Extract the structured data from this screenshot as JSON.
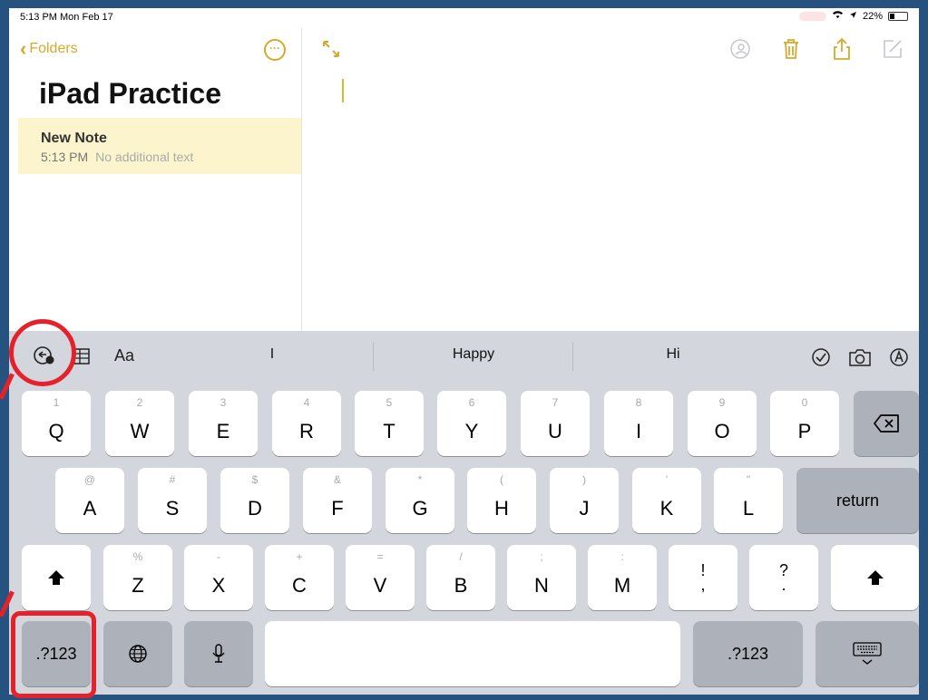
{
  "status": {
    "time": "5:13 PM  Mon Feb 17",
    "battery": "22%"
  },
  "sidebar": {
    "back_label": "Folders",
    "more_icon": "ellipsis-circle-icon",
    "folder_title": "iPad Practice",
    "note": {
      "title": "New Note",
      "time": "5:13 PM",
      "preview": "No additional text"
    }
  },
  "editor": {
    "icons": [
      "expand-icon",
      "collaborate-icon",
      "trash-icon",
      "share-icon",
      "compose-icon"
    ],
    "accent": "#e2b52c"
  },
  "keyboard": {
    "tools": {
      "format_label": "Aa"
    },
    "suggestions": [
      "I",
      "Happy",
      "Hi"
    ],
    "row1": [
      {
        "k": "Q",
        "h": "1"
      },
      {
        "k": "W",
        "h": "2"
      },
      {
        "k": "E",
        "h": "3"
      },
      {
        "k": "R",
        "h": "4"
      },
      {
        "k": "T",
        "h": "5"
      },
      {
        "k": "Y",
        "h": "6"
      },
      {
        "k": "U",
        "h": "7"
      },
      {
        "k": "I",
        "h": "8"
      },
      {
        "k": "O",
        "h": "9"
      },
      {
        "k": "P",
        "h": "0"
      }
    ],
    "row2": [
      {
        "k": "A",
        "h": "@"
      },
      {
        "k": "S",
        "h": "#"
      },
      {
        "k": "D",
        "h": "$"
      },
      {
        "k": "F",
        "h": "&"
      },
      {
        "k": "G",
        "h": "*"
      },
      {
        "k": "H",
        "h": "("
      },
      {
        "k": "J",
        "h": ")"
      },
      {
        "k": "K",
        "h": "'"
      },
      {
        "k": "L",
        "h": "\""
      }
    ],
    "row3": [
      {
        "k": "Z",
        "h": "%"
      },
      {
        "k": "X",
        "h": "-"
      },
      {
        "k": "C",
        "h": "+"
      },
      {
        "k": "V",
        "h": "="
      },
      {
        "k": "B",
        "h": "/"
      },
      {
        "k": "N",
        "h": ";"
      },
      {
        "k": "M",
        "h": ":"
      }
    ],
    "punct1": {
      "top": "!",
      "bottom": ","
    },
    "punct2": {
      "top": "?",
      "bottom": "."
    },
    "return_label": "return",
    "numbers_label": ".?123",
    "annotation_color": "#e5222b"
  }
}
